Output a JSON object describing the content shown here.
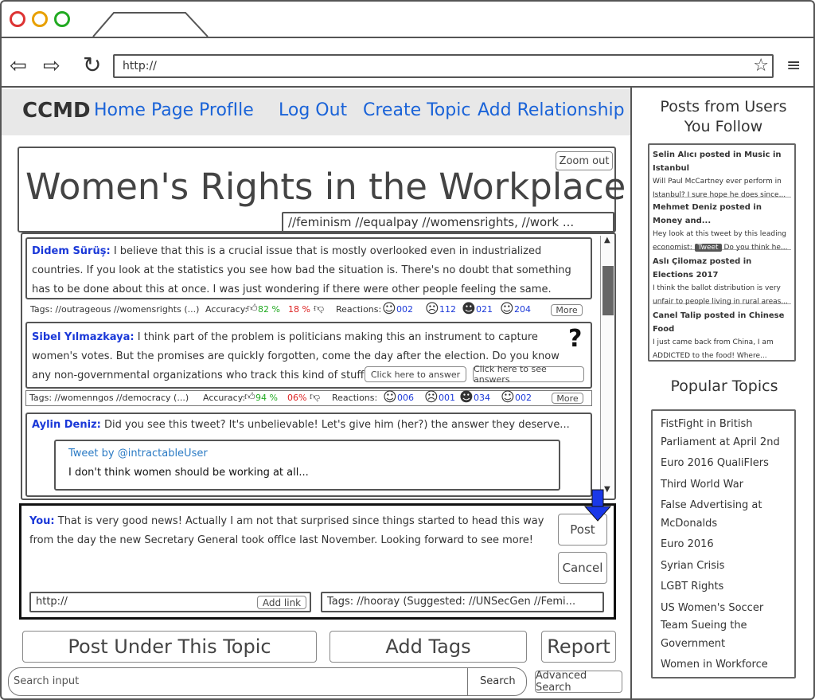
{
  "browser": {
    "url": "http://"
  },
  "nav": {
    "brand": "CCMD",
    "links": [
      "Home Page",
      "ProfIle",
      "Log Out",
      "Create Topic",
      "Add Relationship"
    ]
  },
  "topic": {
    "title": "Women's Rights in the Workplace",
    "zoom_label": "Zoom out",
    "tags": "//feminism //equalpay //womensrights, //work ..."
  },
  "posts": [
    {
      "author": "Didem Sürüş:",
      "text": "I believe that this is a crucial issue that is mostly overlooked even in industrialized countries. If you look at the statistics you see how bad the situation is. There's no doubt that something has to be done about this at once. I was just wondering if there were other people feeling the same.",
      "tags": "Tags: //outrageous //womensrights (...)",
      "accuracy_label": "Accuracy:",
      "acc_up": "82 %",
      "acc_down": "18 %",
      "reactions_label": "Reactions:",
      "reactions": [
        "002",
        "112",
        "021",
        "204"
      ],
      "more": "More"
    },
    {
      "author": "Sibel Yılmazkaya:",
      "text": "I think part of the problem is politicians making this an instrument to capture women's votes. But the promises are quickly forgotten, come the day after the election. Do you know any non-governmental organizations who track this kind of stuff?",
      "answer_btn": "Click here to answer",
      "see_btn": "Click here to see answers",
      "tags": "Tags: //womenngos //democracy (...)",
      "accuracy_label": "Accuracy:",
      "acc_up": "94 %",
      "acc_down": "06%",
      "reactions_label": "Reactions:",
      "reactions": [
        "006",
        "001",
        "034",
        "002"
      ],
      "more": "More"
    },
    {
      "author": "Aylin Deniz:",
      "text": "Did you see this tweet? It's unbelievable! Let's give him (her?) the answer they deserve...",
      "tweet_by": "Tweet by @intractableUser",
      "tweet_text": "I don't think women should be working at all..."
    }
  ],
  "compose": {
    "you_label": "You:",
    "text": "That is very good news! Actually I am not that surprised since things started to head this way from the day the new Secretary General took offIce last November. Looking forward to see more!",
    "post_btn": "Post",
    "cancel_btn": "Cancel",
    "link_placeholder": "http://",
    "add_link": "Add link",
    "tags_text": "Tags: //hooray (Suggested: //UNSecGen //Femi..."
  },
  "actions": {
    "post_under": "Post Under This Topic",
    "add_tags": "Add Tags",
    "report": "Report"
  },
  "search": {
    "placeholder": "Search input",
    "button": "Search",
    "advanced": "Advanced Search"
  },
  "sidebar": {
    "follow_title": "Posts from Users You Follow",
    "follow_items": [
      {
        "header": "Selin Alıcı posted in Music in Istanbul",
        "body": "Will Paul McCartney ever perform in Istanbul? I sure hope he does since..."
      },
      {
        "header": "Mehmet Deniz posted in Money and...",
        "body_before": "Hey look at this tweet by this leading economist:",
        "tweet": "Tweet",
        "body_after": "Do you think he..."
      },
      {
        "header": "Aslı Çilomaz posted in Elections 2017",
        "body": "I think the ballot distribution is very unfair to people living in rural areas..."
      },
      {
        "header": "Canel Talip posted in Chinese Food",
        "body": "I just came back from China, I am ADDICTED to the food! Where..."
      }
    ],
    "popular_title": "Popular Topics",
    "popular_items": [
      "FistFight in British Parliament at April 2nd",
      "Euro 2016 QualiFIers",
      "Third World War",
      "False Advertising at McDonalds",
      "Euro 2016",
      "Syrian Crisis",
      "LGBT Rights",
      "US Women's Soccer Team Sueing the Government",
      "Women in Workforce"
    ]
  }
}
